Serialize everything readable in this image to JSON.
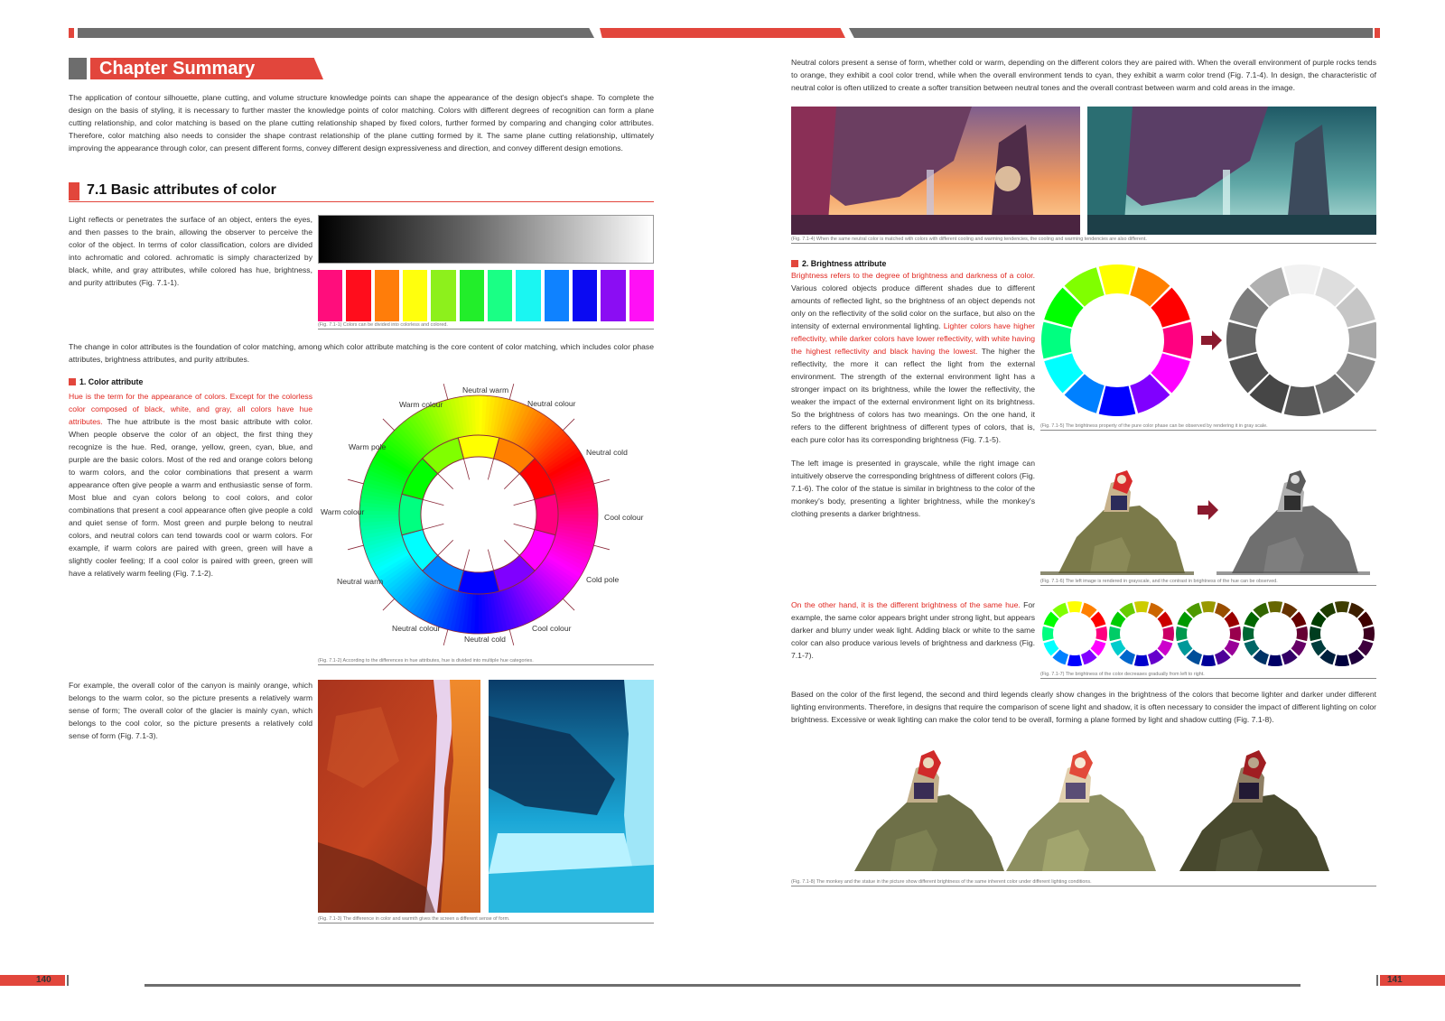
{
  "left_page": {
    "chapter_title": "Chapter Summary",
    "intro": "The application of contour silhouette, plane cutting, and volume structure knowledge points can shape the appearance of the design object's shape. To complete the design on the basis of styling, it is necessary to further master the knowledge points of color matching. Colors with different degrees of recognition can form a plane cutting relationship, and color matching is based on the plane cutting relationship shaped by fixed colors, further formed by comparing and changing color attributes. Therefore, color matching also needs to consider the shape contrast relationship of the plane cutting formed by it. The same plane cutting relationship, ultimately improving the appearance through color, can present different forms, convey different design expressiveness and direction, and convey different design emotions.",
    "section_title": "7.1 Basic attributes of color",
    "sec71_text": "Light reflects or penetrates the surface of an object, enters the eyes, and then passes to the brain, allowing the observer to perceive the color of the object. In terms of color classification, colors are divided into achromatic and colored. achromatic is simply characterized by black, white, and gray attributes, while colored has hue, brightness, and purity attributes (Fig. 7.1-1).",
    "fig711_caption": "(Fig. 7.1-1) Colors can be divided into colorless and colored.",
    "swatches": [
      "#ff0d7c",
      "#ff0d1c",
      "#ff7d0a",
      "#ffff0d",
      "#8df01c",
      "#22ee2a",
      "#1aff85",
      "#1af6f2",
      "#0f82ff",
      "#0b0af2",
      "#8b0df3",
      "#ff10f6"
    ],
    "change_text": "The change in color attributes is the foundation of color matching, among which color attribute matching is the core content of color matching, which includes color phase attributes, brightness attributes, and purity attributes.",
    "color_attr_heading": "1. Color attribute",
    "color_attr_red": "Hue is the term for the appearance of colors. Except for the colorless color composed of black, white, and gray, all colors have hue attributes.",
    "color_attr_text": " The hue attribute is the most basic attribute with color. When people observe the color of an object, the first thing they recognize is the hue. Red, orange, yellow, green, cyan, blue, and purple are the basic colors. Most of the red and orange colors belong to warm colors, and the color combinations that present a warm appearance often give people a warm and enthusiastic sense of form. Most blue and cyan colors belong to cool colors, and color combinations that present a cool appearance often give people a cold and quiet sense of form. Most green and purple belong to neutral colors, and neutral colors can tend towards cool or warm colors. For example, if warm colors are paired with green, green will have a slightly cooler feeling; If a cool color is paired with green, green will have a relatively warm feeling (Fig. 7.1-2).",
    "wheel_labels": {
      "neutral_warm_top": "Neutral warm",
      "neutral_colour_top": "Neutral colour",
      "warm_colour_top": "Warm colour",
      "neutral_cold_right": "Neutral cold",
      "warm_pole": "Warm pole",
      "cool_colour_right": "Cool colour",
      "warm_colour_left": "Warm colour",
      "cold_pole": "Cold pole",
      "neutral_warm_bottom": "Neutral warm",
      "cool_colour_bottom": "Cool colour",
      "neutral_colour_bottom": "Neutral colour",
      "neutral_cold_bottom": "Neutral cold"
    },
    "fig712_caption": "(Fig. 7.1-2) According to the differences in hue attributes, hue is divided into multiple hue categories.",
    "example_text": "For example, the overall color of the canyon is mainly orange, which belongs to the warm color, so the picture presents a relatively warm sense of form; The overall color of the glacier is mainly cyan, which belongs to the cool color, so the picture presents a relatively cold sense of form (Fig. 7.1-3).",
    "fig713_caption": "(Fig. 7.1-3) The difference in color and warmth gives the screen a different sense of form.",
    "page_number": "140"
  },
  "right_page": {
    "neutral_text": "Neutral colors present a sense of form, whether cold or warm, depending on the different colors they are paired with. When the overall environment of purple rocks tends to orange, they exhibit a cool color trend, while when the overall environment tends to cyan, they exhibit a warm color trend (Fig. 7.1-4). In design, the characteristic of neutral color is often utilized to create a softer transition between neutral tones and the overall contrast between warm and cold areas in the image.",
    "fig714_caption": "(Fig. 7.1-4) When the same neutral color is matched with colors with different cooling and warming tendencies, the cooling and warming tendencies are also different.",
    "brightness_heading": "2. Brightness attribute",
    "brightness_red1": "Brightness refers to the degree of brightness and darkness of a color.",
    "brightness_text1": " Various colored objects produce different shades due to different amounts of reflected light, so the brightness of an object depends not only on the reflectivity of the solid color on the surface, but also on the intensity of external environmental lighting. ",
    "brightness_red2": "Lighter colors have higher reflectivity, while darker colors have lower reflectivity, with white having the highest reflectivity and black having the lowest.",
    "brightness_text2": " The higher the reflectivity, the more it can reflect the light from the external environment. The strength of the external environment light has a stronger impact on its brightness, while the lower the reflectivity, the weaker the impact of the external environment light on its brightness. So the brightness of colors has two meanings. On the one hand, it refers to the different brightness of different types of colors, that is, each pure color has its corresponding brightness (Fig. 7.1-5).",
    "fig715_caption": "(Fig. 7.1-5) The brightness property of the pure color phase can be observed by rendering it in gray scale.",
    "grayscale_text": "The left image is presented in grayscale, while the right image can intuitively observe the corresponding brightness of different colors (Fig. 7.1-6). The color of the statue is similar in brightness to the color of the monkey's body, presenting a lighter brightness, while the monkey's clothing presents a darker brightness.",
    "fig716_caption": "(Fig. 7.1-6) The left image is rendered in grayscale, and the contrast in brightness of the hue can be observed.",
    "other_red": "On the other hand, it is the different brightness of the same hue.",
    "other_text": " For example, the same color appears bright under strong light, but appears darker and blurry under weak light. Adding black or white to the same color can also produce various levels of brightness and darkness (Fig. 7.1-7).",
    "fig717_caption": "(Fig. 7.1-7) The brightness of the color decreases gradually from left to right.",
    "based_text": "Based on the color of the first legend, the second and third legends clearly show changes in the brightness of the colors that become lighter and darker under different lighting environments. Therefore, in designs that require the comparison of scene light and shadow, it is often necessary to consider the impact of different lighting on color brightness. Excessive or weak lighting can make the color tend to be overall, forming a plane formed by light and shadow cutting (Fig. 7.1-8).",
    "fig718_caption": "(Fig. 7.1-8) The monkey and the statue in the picture show different brightness of the same inherent color under different lighting conditions.",
    "page_number": "141"
  },
  "colors": {
    "accent": "#e2463c",
    "gray_bar": "#6d6d6d",
    "red_text": "#e0261f"
  }
}
